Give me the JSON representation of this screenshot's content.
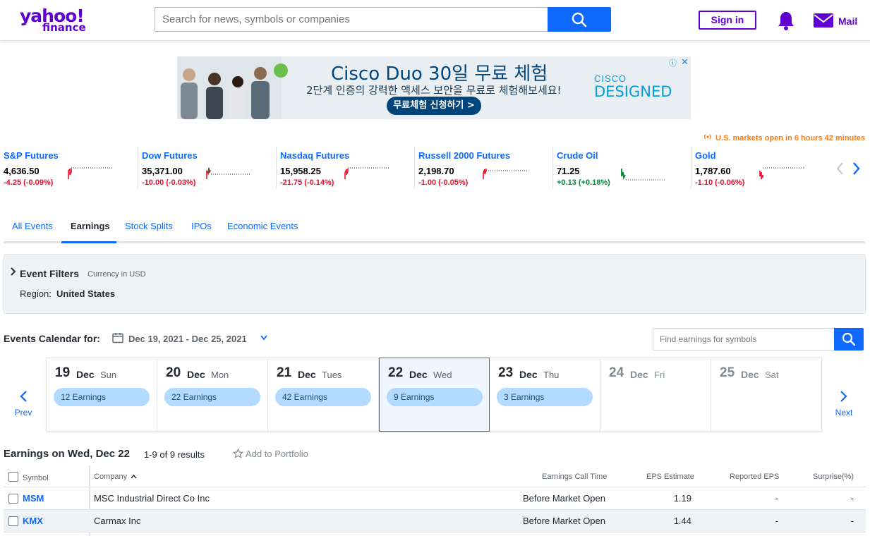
{
  "header": {
    "logo_top": "yahoo!",
    "logo_bottom": "finance",
    "search_placeholder": "Search for news, symbols or companies",
    "signin_label": "Sign in",
    "mail_label": "Mail",
    "brand_color": "#6001d2",
    "accent_color": "#0f69ff"
  },
  "ad": {
    "title": "Cisco Duo 30일 무료 체험",
    "subtitle": "2단계 인증의 강력한 액세스 보안을 무료로 체험해보세요!",
    "cta": "무료체험 신청하기 >",
    "brand_line1": "CISCO",
    "brand_line2": "DESIGNED",
    "info_icon": "ⓘ",
    "close_icon": "✕"
  },
  "market_status": "U.S. markets open in 6 hours 42 minutes",
  "tickers": [
    {
      "name": "S&P Futures",
      "price": "4,636.50",
      "change": "-4.25 (-0.09%)",
      "direction": "neg"
    },
    {
      "name": "Dow Futures",
      "price": "35,371.00",
      "change": "-10.00 (-0.03%)",
      "direction": "neg"
    },
    {
      "name": "Nasdaq Futures",
      "price": "15,958.25",
      "change": "-21.75 (-0.14%)",
      "direction": "neg"
    },
    {
      "name": "Russell 2000 Futures",
      "price": "2,198.70",
      "change": "-1.00 (-0.05%)",
      "direction": "neg"
    },
    {
      "name": "Crude Oil",
      "price": "71.25",
      "change": "+0.13 (+0.18%)",
      "direction": "pos"
    },
    {
      "name": "Gold",
      "price": "1,787.60",
      "change": "-1.10 (-0.06%)",
      "direction": "neg"
    }
  ],
  "tabs": [
    "All Events",
    "Earnings",
    "Stock Splits",
    "IPOs",
    "Economic Events"
  ],
  "filters": {
    "title": "Event Filters",
    "currency": "Currency in USD",
    "region_label": "Region:",
    "region_value": "United States"
  },
  "calendar": {
    "label": "Events Calendar for:",
    "range": "Dec 19, 2021 - Dec 25, 2021",
    "find_placeholder": "Find earnings for symbols",
    "prev_label": "Prev",
    "next_label": "Next",
    "days": [
      {
        "num": "19",
        "mon": "Dec",
        "dow": "Sun",
        "pill": "12 Earnings"
      },
      {
        "num": "20",
        "mon": "Dec",
        "dow": "Mon",
        "pill": "22 Earnings"
      },
      {
        "num": "21",
        "mon": "Dec",
        "dow": "Tues",
        "pill": "42 Earnings"
      },
      {
        "num": "22",
        "mon": "Dec",
        "dow": "Wed",
        "pill": "9 Earnings"
      },
      {
        "num": "23",
        "mon": "Dec",
        "dow": "Thu",
        "pill": "3 Earnings"
      },
      {
        "num": "24",
        "mon": "Dec",
        "dow": "Fri",
        "pill": ""
      },
      {
        "num": "25",
        "mon": "Dec",
        "dow": "Sat",
        "pill": ""
      }
    ]
  },
  "results": {
    "title": "Earnings on Wed, Dec 22",
    "count": "1-9 of 9 results",
    "add_portfolio": "Add to Portfolio"
  },
  "table": {
    "headers": {
      "symbol": "Symbol",
      "company": "Company",
      "call_time": "Earnings Call Time",
      "eps_estimate": "EPS Estimate",
      "reported_eps": "Reported EPS",
      "surprise": "Surprise(%)"
    },
    "rows": [
      {
        "symbol": "MSM",
        "company": "MSC Industrial Direct Co Inc",
        "call_time": "Before Market Open",
        "eps_estimate": "1.19",
        "reported_eps": "-",
        "surprise": "-"
      },
      {
        "symbol": "KMX",
        "company": "Carmax Inc",
        "call_time": "Before Market Open",
        "eps_estimate": "1.44",
        "reported_eps": "-",
        "surprise": "-"
      }
    ]
  }
}
